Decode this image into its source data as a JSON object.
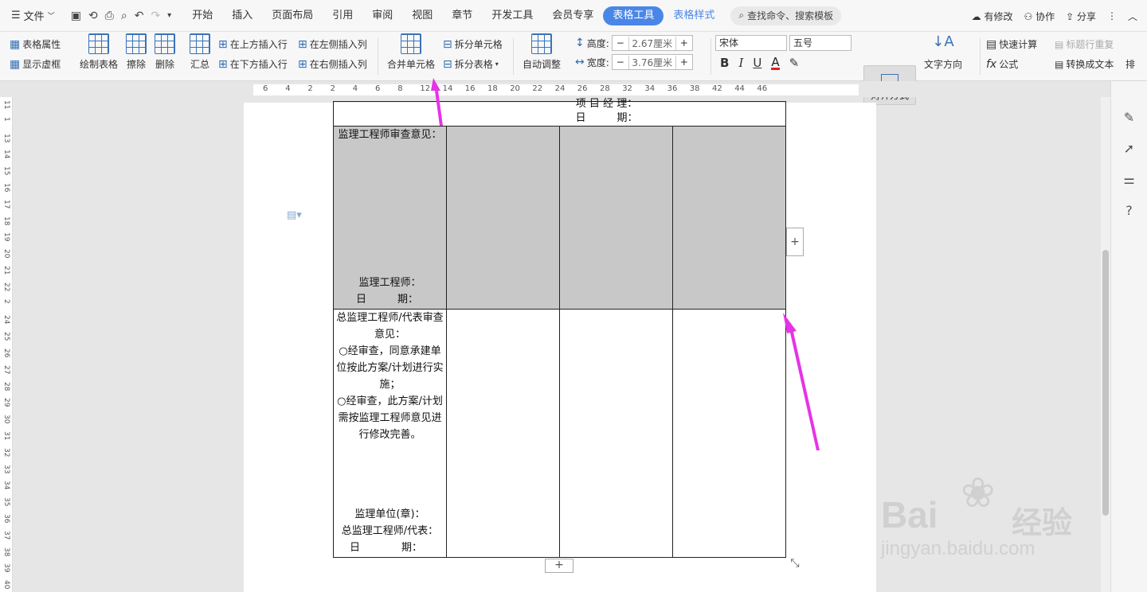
{
  "menubar": {
    "file_label": "文件",
    "tabs": [
      "开始",
      "插入",
      "页面布局",
      "引用",
      "审阅",
      "视图",
      "章节",
      "开发工具",
      "会员专享"
    ],
    "active_tab": "表格工具",
    "alt_tab": "表格样式",
    "search_placeholder": "查找命令、搜索模板",
    "modified": "有修改",
    "collab": "协作",
    "share": "分享"
  },
  "ribbon": {
    "table_props": "表格属性",
    "show_grid": "显示虚框",
    "draw_table": "绘制表格",
    "erase": "擦除",
    "delete": "删除",
    "summary": "汇总",
    "insert_above": "在上方插入行",
    "insert_below": "在下方插入行",
    "insert_left": "在左侧插入列",
    "insert_right": "在右侧插入列",
    "merge_cells": "合并单元格",
    "split_cells": "拆分单元格",
    "split_table": "拆分表格",
    "auto_adjust": "自动调整",
    "height_label": "高度:",
    "height_value": "2.67厘米",
    "width_label": "宽度:",
    "width_value": "3.76厘米",
    "font_name": "宋体",
    "font_size": "五号",
    "align": "对齐方式",
    "text_direction": "文字方向",
    "quick_calc": "快速计算",
    "repeat_header": "标题行重复",
    "formula": "公式",
    "convert_text": "转换成文本",
    "sort": "排"
  },
  "ruler_h": [
    "6",
    "4",
    "2",
    "2",
    "4",
    "6",
    "8",
    "12",
    "14",
    "16",
    "18",
    "20",
    "22",
    "24",
    "26",
    "28",
    "32",
    "34",
    "36",
    "38",
    "42",
    "44",
    "46"
  ],
  "ruler_v": [
    "11",
    "1",
    "13",
    "14",
    "15",
    "16",
    "17",
    "18",
    "19",
    "20",
    "21",
    "22",
    "2",
    "24",
    "25",
    "26",
    "27",
    "28",
    "29",
    "30",
    "31",
    "32",
    "33",
    "34",
    "35",
    "36",
    "37",
    "38",
    "39",
    "40"
  ],
  "table": {
    "top_fragment_line1": "项 目 经 理：",
    "top_fragment_line2": "日　　　期：",
    "row1_title": "监理工程师审查意见：",
    "row1_sign": "监理工程师：",
    "row1_date": "日　　　期：",
    "row2_title": "总监理工程师/代表审查意见：",
    "row2_opt1": "○经审查，同意承建单位按此方案/计划进行实施；",
    "row2_opt2": "○经审查，此方案/计划需按监理工程师意见进行修改完善。",
    "row2_sign1": "监理单位(章)：",
    "row2_sign2": "总监理工程师/代表：",
    "row2_date": "日　　　　期："
  },
  "watermark": {
    "brand": "Bai",
    "suffix": "经验",
    "url": "jingyan.baidu.com"
  },
  "colors": {
    "accent": "#4a86e8",
    "arrow": "#e633e6",
    "shade": "#c8c8c8"
  }
}
